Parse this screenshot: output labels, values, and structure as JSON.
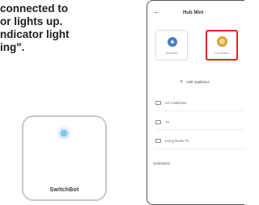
{
  "instructions": {
    "lines": [
      "connected to",
      "or lights up.",
      "ndicator light",
      "ing\"."
    ]
  },
  "hub_device": {
    "logo": "SwitchBot",
    "led_color": "#7cc7ee"
  },
  "phone": {
    "header": {
      "title": "Hub Mini",
      "back_icon": "back-arrow-icon"
    },
    "tiles": [
      {
        "label": "Sceadle",
        "icon": "hub-mini-icon",
        "selected": false
      },
      {
        "label": "Lot Settra",
        "icon": "bulb-icon",
        "selected": true
      }
    ],
    "add_appliance_label": "Add Appliance",
    "appliances": [
      {
        "label": "Air conditioner",
        "icon": "device-icon"
      },
      {
        "label": "TV",
        "icon": "device-icon"
      },
      {
        "label": "Living Room TV",
        "icon": "device-icon"
      }
    ],
    "section_label": "SwitchBots"
  },
  "colors": {
    "selected_border": "#e2231a",
    "led": "#7cc7ee",
    "hub_icon": "#4a7fc1",
    "bulb_icon": "#d9a23a"
  }
}
